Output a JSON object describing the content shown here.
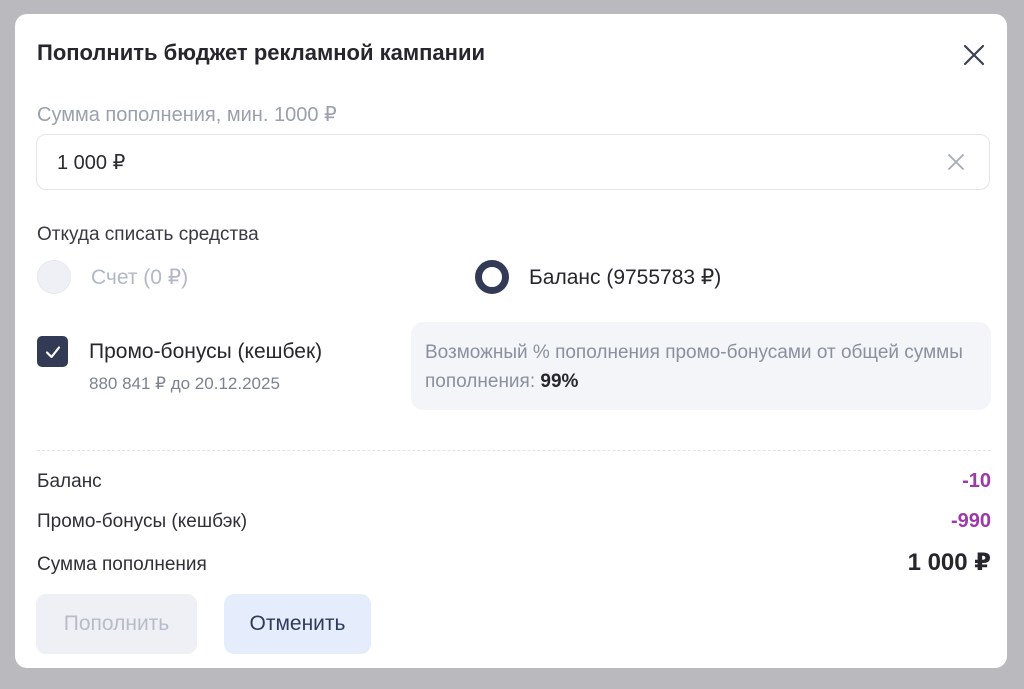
{
  "modal": {
    "title": "Пополнить бюджет рекламной кампании"
  },
  "amount": {
    "label": "Сумма пополнения, мин. 1000 ₽",
    "value": "1 000 ₽"
  },
  "source": {
    "label": "Откуда списать средства",
    "options": [
      {
        "label": "Счет (0 ₽)",
        "selected": false,
        "disabled": true
      },
      {
        "label": "Баланс (9755783 ₽)",
        "selected": true,
        "disabled": false
      }
    ]
  },
  "promo": {
    "checked": true,
    "title": "Промо-бонусы (кешбек)",
    "subtitle": "880 841 ₽ до 20.12.2025",
    "info_text": "Возможный % пополнения промо-бонусами от общей суммы пополнения:",
    "info_percent": "99%"
  },
  "summary": {
    "rows": [
      {
        "label": "Баланс",
        "value": "-10"
      },
      {
        "label": "Промо-бонусы (кешбэк)",
        "value": "-990"
      },
      {
        "label": "Сумма пополнения",
        "value": "1 000 ₽"
      }
    ]
  },
  "buttons": {
    "submit_label": "Пополнить",
    "cancel_label": "Отменить"
  },
  "colors": {
    "accent": "#333a55",
    "deduction": "#9b3aa8",
    "cancel_bg": "#e5edfd"
  },
  "icons": {
    "close": "close-icon",
    "clear": "clear-icon",
    "check": "check-icon"
  }
}
